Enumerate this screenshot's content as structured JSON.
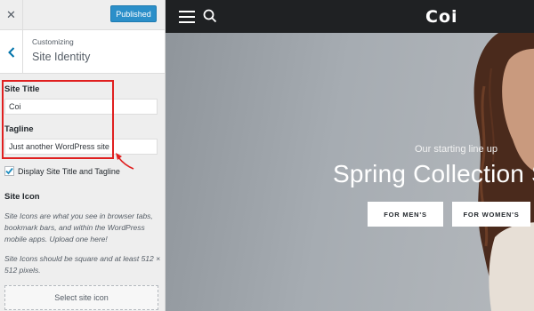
{
  "sidebar": {
    "close_glyph": "✕",
    "publish_label": "Published",
    "breadcrumb": "Customizing",
    "section_title": "Site Identity",
    "site_title": {
      "label": "Site Title",
      "value": "Coi"
    },
    "tagline": {
      "label": "Tagline",
      "value": "Just another WordPress site"
    },
    "display_checkbox": {
      "label": "Display Site Title and Tagline",
      "checked": true
    },
    "site_icon": {
      "title": "Site Icon",
      "desc1": "Site Icons are what you see in browser tabs, bookmark bars, and within the WordPress mobile apps. Upload one here!",
      "desc2": "Site Icons should be square and at least 512 × 512 pixels.",
      "button_label": "Select site icon"
    }
  },
  "preview": {
    "logo": "Coi",
    "hero_tagline": "Our starting line up",
    "hero_title": "Spring Collection SS",
    "buttons": [
      "FOR MEN'S",
      "FOR WOMEN'S"
    ]
  },
  "colors": {
    "accent": "#2b8fc9",
    "highlight": "#e02020",
    "header_bg": "#1f2123"
  }
}
